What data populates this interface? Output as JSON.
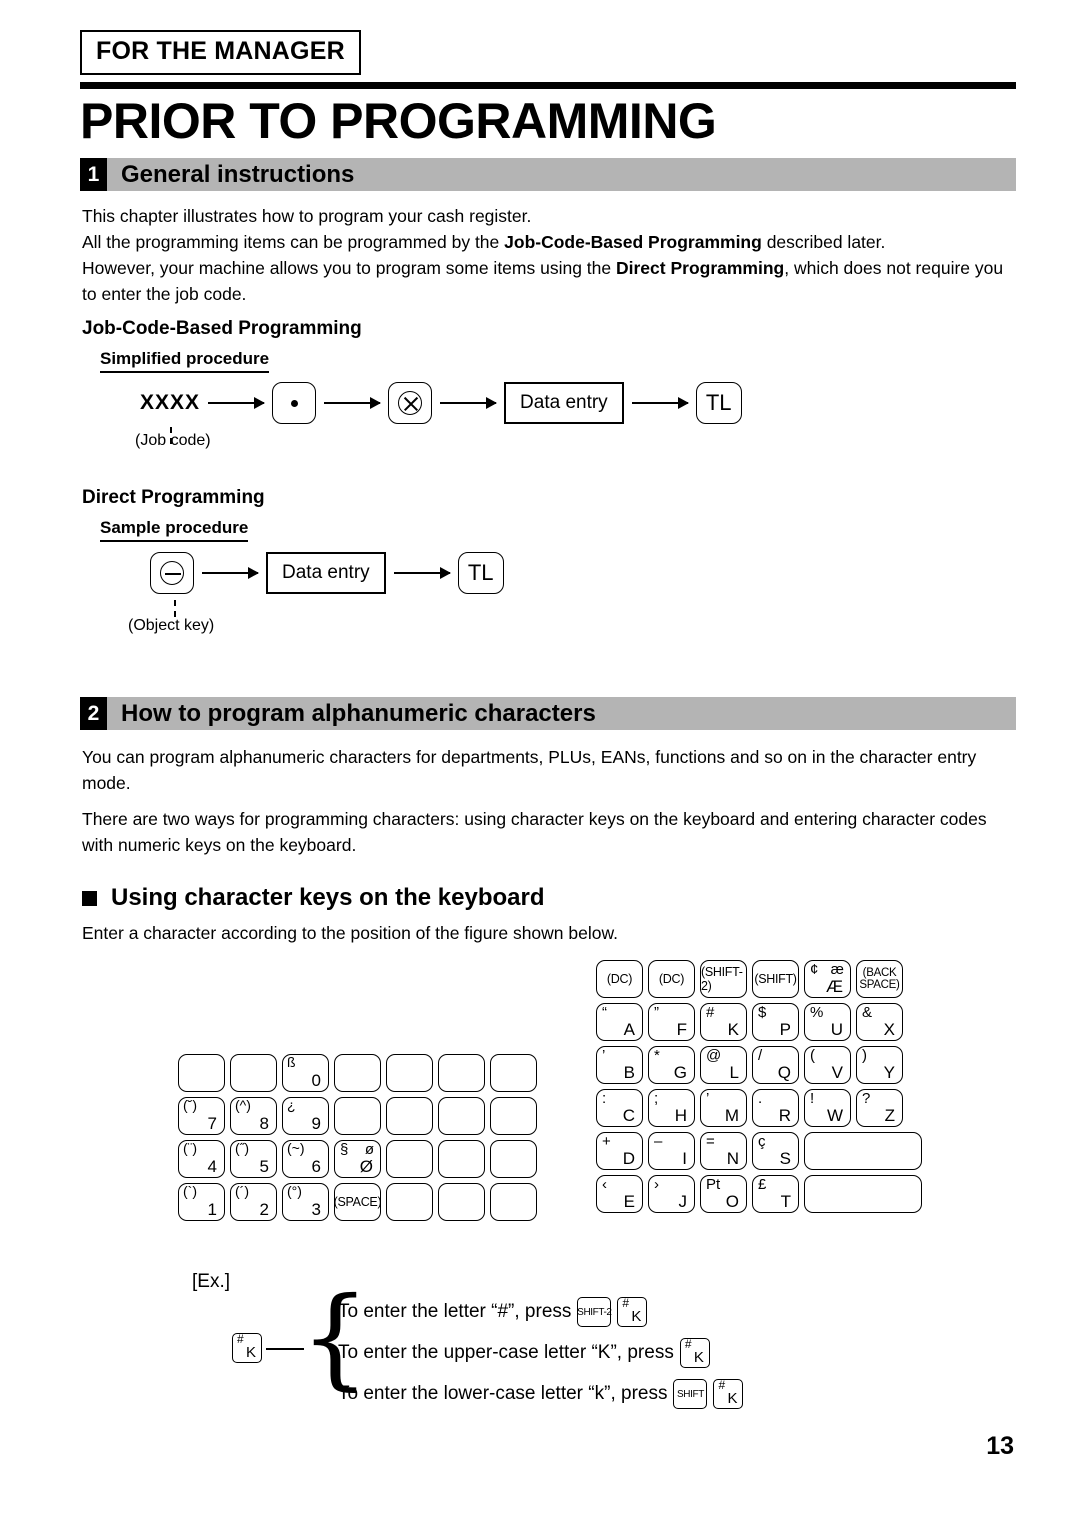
{
  "header": {
    "manager_tag": "FOR THE MANAGER",
    "doc_title": "PRIOR TO PROGRAMMING"
  },
  "sections": [
    {
      "number": "1",
      "title": "General instructions"
    },
    {
      "number": "2",
      "title": "How to program alphanumeric characters"
    }
  ],
  "body": {
    "p1_line1": "This chapter illustrates how to program your cash register.",
    "p1_line2_a": "All the programming items can be programmed by the ",
    "p1_line2_b": "Job-Code-Based Programming",
    "p1_line2_c": " described later.",
    "p1_line3_a": "However, your machine allows you to program some items using the ",
    "p1_line3_b": "Direct Programming",
    "p1_line3_c": ", which does not require you to enter the job code.",
    "p2": "You can program alphanumeric characters for departments, PLUs, EANs, functions and so on in the character entry mode.",
    "p3": "There are two ways for programming characters: using character keys on the keyboard and entering character codes with numeric keys on the keyboard.",
    "p4": "Enter a character according to the position of the figure shown below."
  },
  "headings": {
    "job_code_based": "Job-Code-Based Programming",
    "simplified_procedure": "Simplified procedure",
    "direct_programming": "Direct Programming",
    "sample_procedure": "Sample procedure",
    "using_character_keys": "Using character keys on the keyboard"
  },
  "flow_simplified": {
    "job_code_label": "XXXX",
    "job_code_note": "(Job code)",
    "key_dot": "decimal-point-key",
    "key_multiply": "multiply-key",
    "data_entry": "Data entry",
    "key_tl": "TL"
  },
  "flow_direct": {
    "key_minus": "minus-key",
    "object_key_note": "(Object key)",
    "data_entry": "Data entry",
    "key_tl": "TL"
  },
  "keyboard": {
    "left": {
      "cols": 7,
      "rows": [
        [
          {
            "blank": true
          },
          {
            "blank": true
          },
          {
            "acc": "ß",
            "main": "0"
          },
          {
            "blank": true
          },
          {
            "blank": true
          },
          {
            "blank": true
          },
          {
            "blank": true
          }
        ],
        [
          {
            "acc": "(˘)",
            "main": "7"
          },
          {
            "acc": "(^)",
            "main": "8"
          },
          {
            "acc": "¿",
            "main": "9"
          },
          {
            "blank": true
          },
          {
            "blank": true
          },
          {
            "blank": true
          },
          {
            "blank": true
          }
        ],
        [
          {
            "acc": "(¨)",
            "main": "4"
          },
          {
            "acc": "(˝)",
            "main": "5"
          },
          {
            "acc": "(~)",
            "main": "6"
          },
          {
            "tl": "§",
            "tr": "ø",
            "br": "Ø"
          },
          {
            "blank": true
          },
          {
            "blank": true
          },
          {
            "blank": true
          }
        ],
        [
          {
            "acc": "(`)",
            "main": "1"
          },
          {
            "acc": "(´)",
            "main": "2"
          },
          {
            "acc": "(°)",
            "main": "3"
          },
          {
            "center": "(SPACE)"
          },
          {
            "blank": true
          },
          {
            "blank": true
          },
          {
            "blank": true
          }
        ]
      ]
    },
    "right": {
      "cols": 6,
      "rows": [
        [
          {
            "center": "(DC)"
          },
          {
            "center": "(DC)"
          },
          {
            "center": "(SHIFT-2)"
          },
          {
            "center": "(SHIFT)"
          },
          {
            "tl": "¢",
            "tr": "æ",
            "br": "Æ"
          },
          {
            "center2": [
              "(BACK",
              "SPACE)"
            ]
          }
        ],
        [
          {
            "tl": "“",
            "main": "A"
          },
          {
            "tl": "”",
            "main": "F"
          },
          {
            "tl": "#",
            "main": "K"
          },
          {
            "tl": "$",
            "main": "P"
          },
          {
            "tl": "%",
            "main": "U"
          },
          {
            "tl": "&",
            "main": "X"
          }
        ],
        [
          {
            "tl": "’",
            "main": "B"
          },
          {
            "tl": "*",
            "main": "G"
          },
          {
            "tl": "@",
            "main": "L"
          },
          {
            "tl": "/",
            "main": "Q"
          },
          {
            "tl": "(",
            "main": "V"
          },
          {
            "tl": ")",
            "main": "Y"
          }
        ],
        [
          {
            "tl": ":",
            "main": "C"
          },
          {
            "tl": ";",
            "main": "H"
          },
          {
            "tl": "’",
            "main": "M"
          },
          {
            "tl": ".",
            "main": "R"
          },
          {
            "tl": "!",
            "main": "W"
          },
          {
            "tl": "?",
            "main": "Z"
          }
        ],
        [
          {
            "tl": "+",
            "main": "D"
          },
          {
            "tl": "–",
            "main": "I"
          },
          {
            "tl": "=",
            "main": "N"
          },
          {
            "tl": "ç",
            "main": "S"
          },
          {
            "wide": true
          }
        ],
        [
          {
            "tl": "‹",
            "main": "E"
          },
          {
            "tl": "›",
            "main": "J"
          },
          {
            "tl": "Pt",
            "main": "O"
          },
          {
            "tl": "£",
            "main": "T"
          },
          {
            "wide": true
          }
        ]
      ]
    }
  },
  "example": {
    "label": "[Ex.]",
    "source_key": {
      "tl": "#",
      "main": "K"
    },
    "lines": [
      {
        "text_before": "To enter the letter “#”, press ",
        "keys": [
          {
            "center": "SHIFT-2"
          },
          {
            "tl": "#",
            "main": "K"
          }
        ]
      },
      {
        "text_before": "To enter the upper-case letter “K”, press ",
        "keys": [
          {
            "tl": "#",
            "main": "K"
          }
        ]
      },
      {
        "text_before": "To enter the lower-case letter “k”, press ",
        "keys": [
          {
            "center": "SHIFT"
          },
          {
            "tl": "#",
            "main": "K"
          }
        ]
      }
    ]
  },
  "footer": {
    "page_number": "13"
  },
  "colors": {
    "banner_gray": "#b4b4b4",
    "ink": "#000000",
    "paper": "#ffffff"
  }
}
